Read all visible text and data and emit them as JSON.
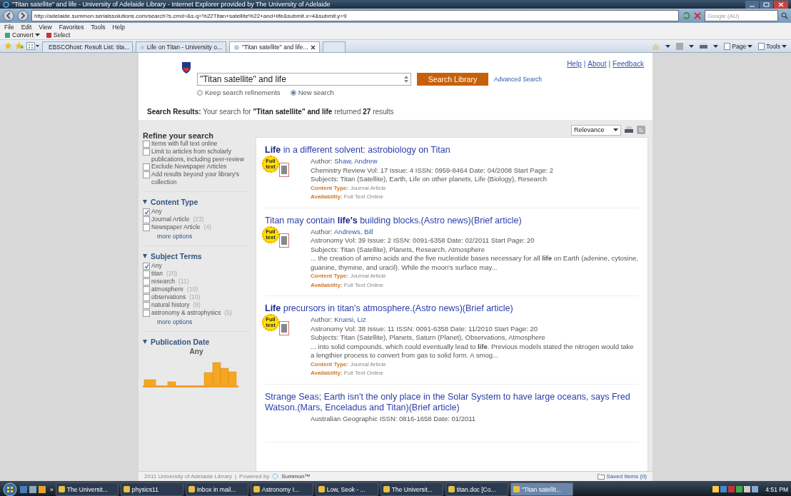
{
  "window": {
    "title": "\"Titan satellite\" and life - University of Adelaide Library - Internet Explorer provided by The University of Adelaide"
  },
  "address_bar": {
    "url": "http://adelaide.summon.serialssolutions.com/search?s.cmd=&s.q=%22Titan+satellite%22+and+life&submit.x=4&submit.y=9",
    "search_placeholder": "Google (AU)"
  },
  "menu_bar": [
    "File",
    "Edit",
    "View",
    "Favorites",
    "Tools",
    "Help"
  ],
  "command_bar": [
    {
      "label": "Convert",
      "menu": true
    },
    {
      "label": "Select",
      "menu": false
    }
  ],
  "tabs": [
    {
      "label": "EBSCOhost: Result List: tita...",
      "selected": false
    },
    {
      "label": "Life on Titan - University o...",
      "selected": false
    },
    {
      "label": "\"Titan satellite\" and life...",
      "selected": true
    }
  ],
  "toolbar_right": [
    {
      "label": "Page",
      "menu": true
    },
    {
      "label": "Tools",
      "menu": true
    }
  ],
  "page": {
    "header_links": [
      "Help",
      "About",
      "Feedback"
    ],
    "link_separator": "|",
    "search": {
      "value": "\"Titan satellite\" and life",
      "button": "Search Library",
      "advanced": "Advanced Search"
    },
    "search_options": [
      {
        "label": "Keep search refinements",
        "selected": false
      },
      {
        "label": "New search",
        "selected": true
      }
    ],
    "summary": "**Search Results:** Your search for **\"Titan satellite\" and life** returned **27** results",
    "sort": {
      "value": "Relevance"
    },
    "sidebar": {
      "title": "Refine your search",
      "refine": [
        {
          "label": "Items with full text online",
          "checked": false
        },
        {
          "label": "Limit to articles from scholarly publications, including peer-review",
          "checked": false
        },
        {
          "label": "Exclude Newspaper Articles",
          "checked": false
        },
        {
          "label": "Add results beyond your library's collection",
          "checked": false
        }
      ],
      "facets": [
        {
          "title": "Content Type",
          "expanded": true,
          "items": [
            {
              "label": "Any",
              "checked": true
            },
            {
              "label": "Journal Article",
              "count": "(23)",
              "checked": false
            },
            {
              "label": "Newspaper Article",
              "count": "(4)",
              "checked": false
            }
          ],
          "more": "more options"
        },
        {
          "title": "Subject Terms",
          "expanded": true,
          "items": [
            {
              "label": "Any",
              "checked": true
            },
            {
              "label": "titan",
              "count": "(20)",
              "checked": false
            },
            {
              "label": "research",
              "count": "(11)",
              "checked": false
            },
            {
              "label": "atmosphere",
              "count": "(10)",
              "checked": false
            },
            {
              "label": "observations",
              "count": "(10)",
              "checked": false
            },
            {
              "label": "natural history",
              "count": "(9)",
              "checked": false
            },
            {
              "label": "astronomy & astrophysics",
              "count": "(5)",
              "checked": false
            }
          ],
          "more": "more options"
        }
      ],
      "publication_date": {
        "title": "Publication Date",
        "expanded": true,
        "value": "Any"
      }
    },
    "results": [
      {
        "title": "**Life** in a different solvent: astrobiology on Titan",
        "badge": "Full text",
        "author_label": "Author:",
        "author": "Shaw, Andrew",
        "details": "Chemistry Review Vol: 17 Issue: 4 ISSN: 0959-8464 Date: 04/2008 Start Page: 2",
        "subjects": "Subjects: Titan (Satellite), Earth, Life on other planets, Life (Biology), Research",
        "content_type_label": "Content Type:",
        "content_type": "Journal Article",
        "availability_label": "Availability:",
        "availability": "Full Text Online"
      },
      {
        "title": "Titan may contain **life's** building blocks.(Astro news)(Brief article)",
        "badge": "Full text",
        "author_label": "Author:",
        "author": "Andrews, Bill",
        "details": "Astronomy Vol: 39 Issue: 2 ISSN: 0091-6358 Date: 02/2011 Start Page: 20",
        "subjects": "Subjects: Titan (Satellite), Planets, Research, Atmosphere",
        "snippet": "... the creation of amino acids and the five nucleotide bases necessary for all **life** on Earth (adenine, cytosine, guanine, thymine, and uracil). While the moon's surface may...",
        "content_type_label": "Content Type:",
        "content_type": "Journal Article",
        "availability_label": "Availability:",
        "availability": "Full Text Online"
      },
      {
        "title": "**Life** precursors in titan's atmosphere.(Astro news)(Brief article)",
        "badge": "Full text",
        "author_label": "Author:",
        "author": "Kruesi, Liz",
        "details": "Astronomy Vol: 38 Issue: 11 ISSN: 0091-6358 Date: 11/2010 Start Page: 20",
        "subjects": "Subjects: Titan (Satellite), Planets, Saturn (Planet), Observations, Atmosphere",
        "snippet": "... into solid compounds, which could eventually lead to **life**. Previous models stated the nitrogen would take a lengthier process to convert from gas to solid form. A smog...",
        "content_type_label": "Content Type:",
        "content_type": "Journal Article",
        "availability_label": "Availability:",
        "availability": "Full Text Online"
      },
      {
        "title": "Strange Seas; Earth isn't the only place in the Solar System to have large oceans, says Fred Watson.(Mars, Enceladus and Titan)(Brief article)",
        "details": "Australian Geographic ISSN: 0816-1658 Date: 01/2011"
      }
    ],
    "footer": {
      "copyright": "2011 University of Adelaide Library",
      "separator": "|",
      "powered_by": "Powered by",
      "brand": "Summon™",
      "saved": "Saved Items (0)"
    }
  },
  "taskbar": {
    "overflow": "»",
    "items": [
      {
        "label": "The Universit...",
        "selected": false
      },
      {
        "label": "physics11",
        "selected": false
      },
      {
        "label": "Inbox in mail...",
        "selected": false
      },
      {
        "label": "Astronomy I...",
        "selected": false
      },
      {
        "label": "Low, Seok - ...",
        "selected": false
      },
      {
        "label": "The Universit...",
        "selected": false
      },
      {
        "label": "titan.doc [Co...",
        "selected": false
      },
      {
        "label": "\"Titan satellit...",
        "selected": true
      }
    ],
    "time": "4:51 PM"
  }
}
